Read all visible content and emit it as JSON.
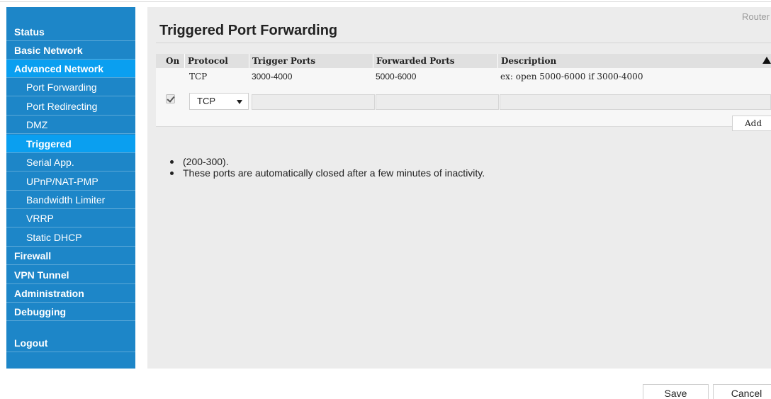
{
  "brand": "Router",
  "sidebar": {
    "items": [
      {
        "label": "Status"
      },
      {
        "label": "Basic Network"
      },
      {
        "label": "Advanced Network"
      },
      {
        "label": "Port Forwarding"
      },
      {
        "label": "Port Redirecting"
      },
      {
        "label": "DMZ"
      },
      {
        "label": "Triggered"
      },
      {
        "label": "Serial App."
      },
      {
        "label": "UPnP/NAT-PMP"
      },
      {
        "label": "Bandwidth Limiter"
      },
      {
        "label": "VRRP"
      },
      {
        "label": "Static DHCP"
      },
      {
        "label": "Firewall"
      },
      {
        "label": "VPN Tunnel"
      },
      {
        "label": "Administration"
      },
      {
        "label": "Debugging"
      },
      {
        "label": "Logout"
      }
    ]
  },
  "main": {
    "title": "Triggered Port Forwarding",
    "table": {
      "headers": [
        "On",
        "Protocol",
        "Trigger Ports",
        "Forwarded Ports",
        "Description"
      ],
      "rows": [
        {
          "on": "",
          "protocol": "TCP",
          "trigger_ports": "3000-4000",
          "forwarded_ports": "5000-6000",
          "description": "ex: open 5000-6000 if 3000-4000"
        }
      ],
      "new_row": {
        "on_checked": true,
        "protocol": "TCP",
        "trigger_ports": "",
        "forwarded_ports": "",
        "description": ""
      },
      "add_label": "Add"
    },
    "notes": [
      "(200-300).",
      "These ports are automatically closed after a few minutes of inactivity."
    ]
  },
  "footer": {
    "save_label": "Save",
    "cancel_label": "Cancel"
  },
  "colors": {
    "sidebar_bg": "#1d86c8",
    "sidebar_active": "#0a9ff0",
    "panel_bg": "#ececec"
  }
}
